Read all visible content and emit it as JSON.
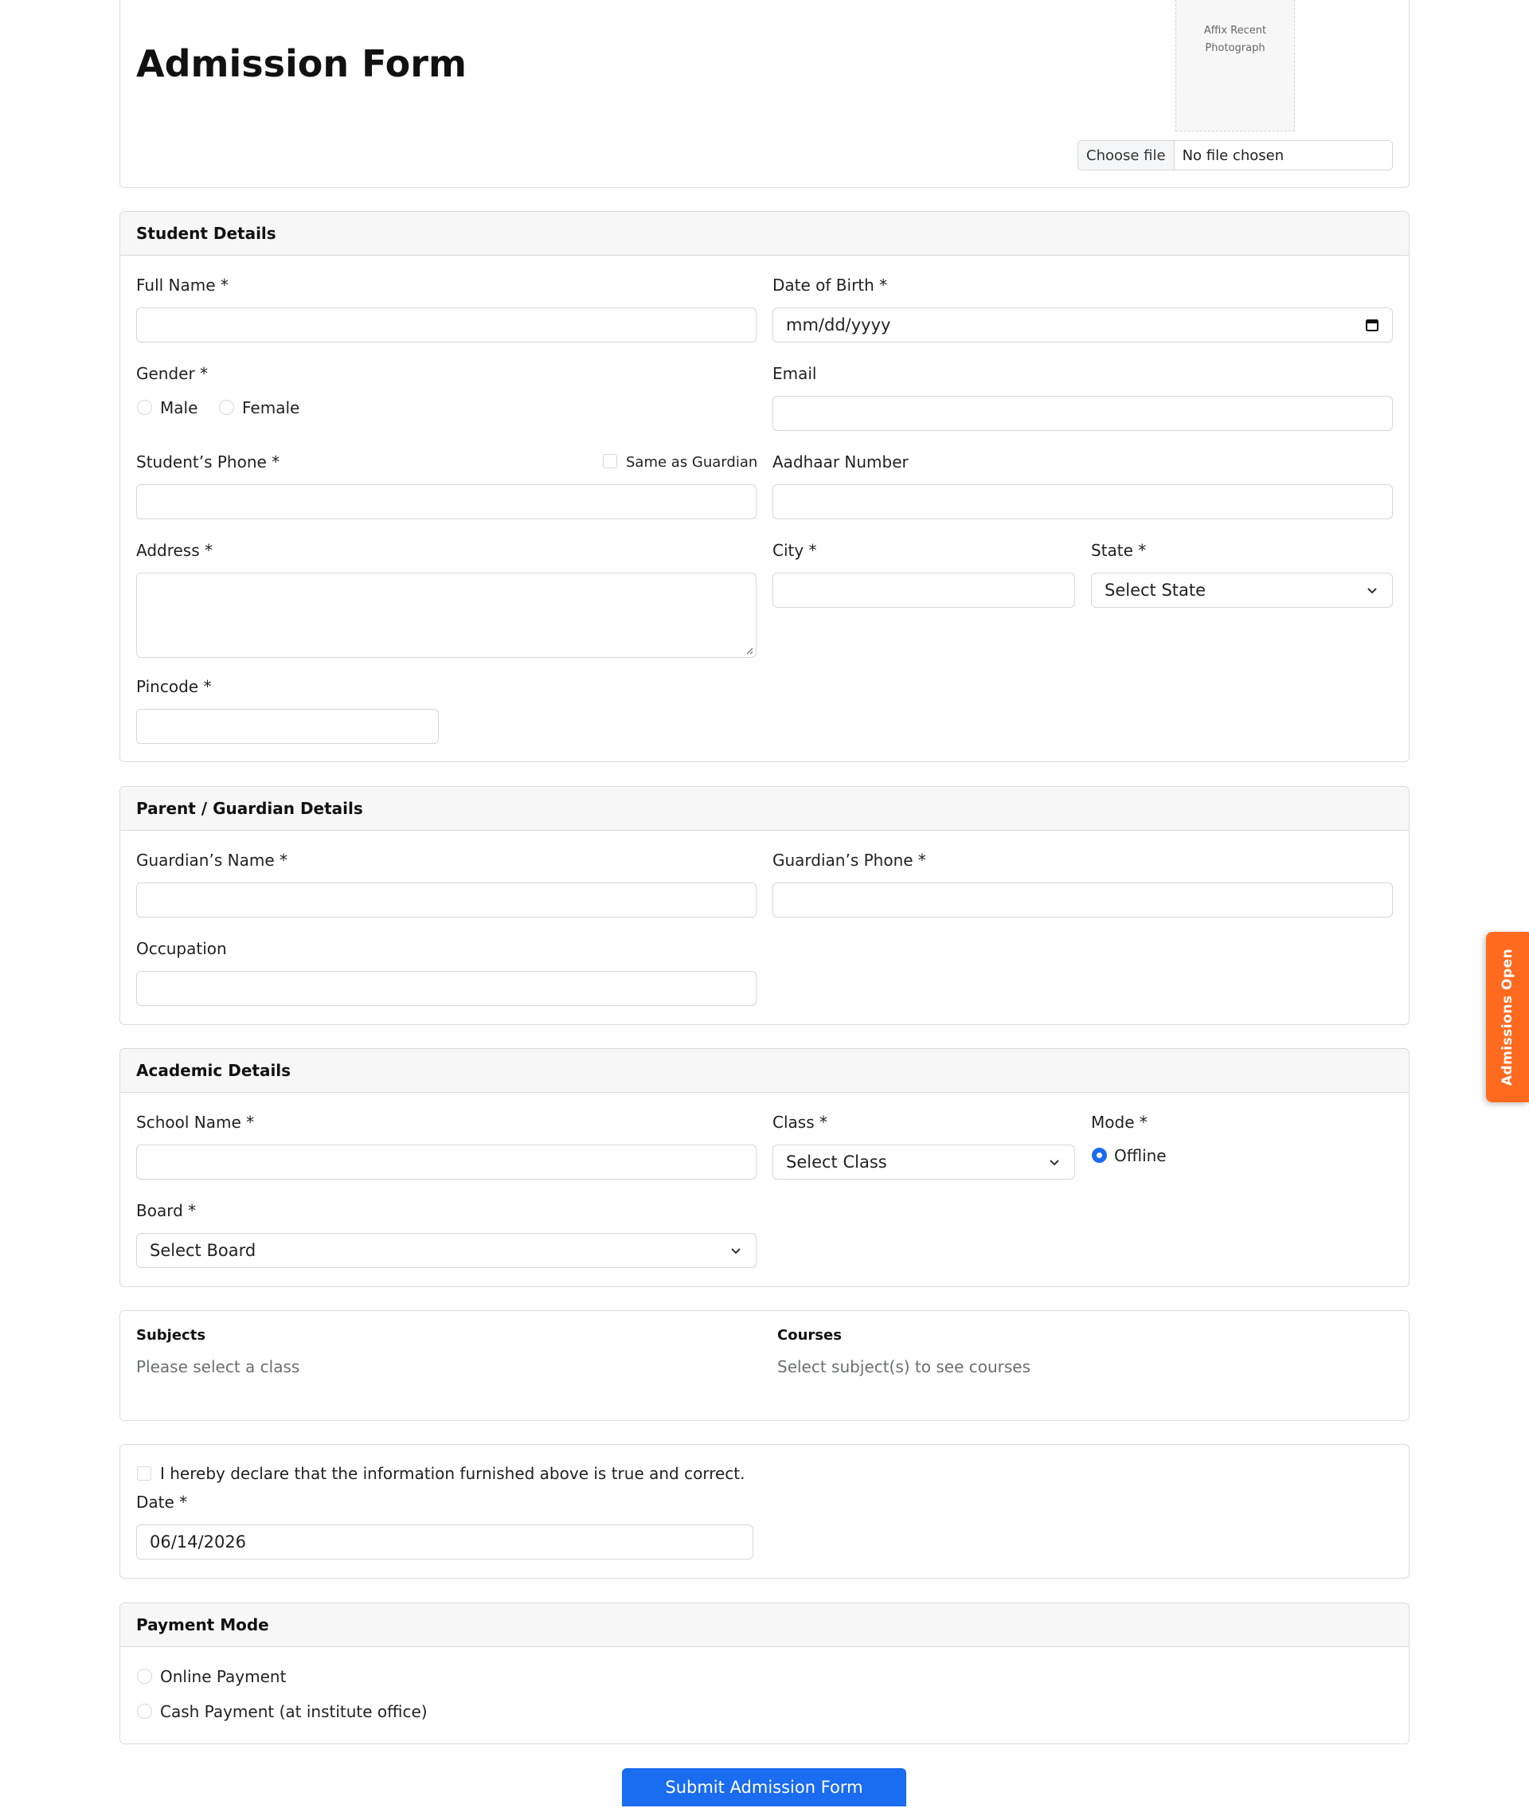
{
  "header": {
    "title": "Admission Form",
    "photo_placeholder": "Affix Recent Photograph",
    "file_button": "Choose file",
    "file_status": "No file chosen"
  },
  "student": {
    "heading": "Student Details",
    "full_name_label": "Full Name *",
    "dob_label": "Date of Birth *",
    "dob_value": "mm/dd/yyyy",
    "gender_label": "Gender *",
    "gender_male": "Male",
    "gender_female": "Female",
    "email_label": "Email",
    "phone_label": "Student’s Phone *",
    "same_as_guardian": "Same as Guardian",
    "aadhaar_label": "Aadhaar Number",
    "address_label": "Address *",
    "city_label": "City *",
    "state_label": "State *",
    "state_selected": "Select State",
    "pincode_label": "Pincode *"
  },
  "guardian": {
    "heading": "Parent / Guardian Details",
    "name_label": "Guardian’s Name *",
    "phone_label": "Guardian’s Phone *",
    "occupation_label": "Occupation"
  },
  "academic": {
    "heading": "Academic Details",
    "school_label": "School Name *",
    "class_label": "Class *",
    "class_selected": "Select Class",
    "mode_label": "Mode *",
    "mode_offline": "Offline",
    "board_label": "Board *",
    "board_selected": "Select Board"
  },
  "subjects": {
    "subjects_heading": "Subjects",
    "subjects_hint": "Please select a class",
    "courses_heading": "Courses",
    "courses_hint": "Select subject(s) to see courses"
  },
  "declaration": {
    "text": "I hereby declare that the information furnished above is true and correct.",
    "date_label": "Date *",
    "date_value": "06/14/2026"
  },
  "payment": {
    "heading": "Payment Mode",
    "online": "Online Payment",
    "cash": "Cash Payment (at institute office)"
  },
  "submit_label": "Submit Admission Form",
  "side_tab": "Admissions Open",
  "colors": {
    "accent": "#1a6cf0",
    "side_tab": "#ff6a1f"
  }
}
